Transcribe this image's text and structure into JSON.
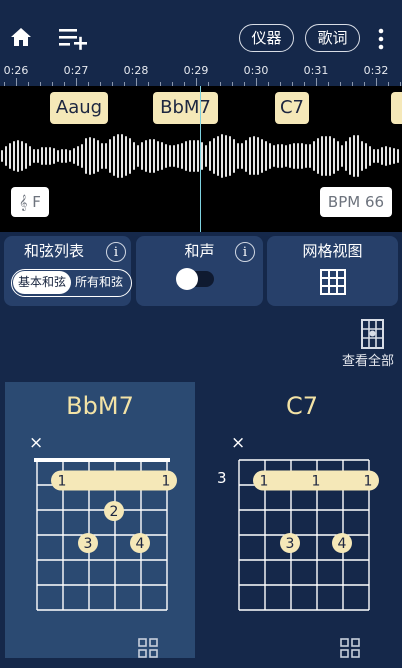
{
  "header": {
    "home_icon": "home-icon",
    "playlist_icon": "playlist-add-icon",
    "instrument_label": "仪器",
    "lyrics_label": "歌词",
    "more_icon": "more-vertical-icon"
  },
  "timeline": {
    "labels": [
      "0:26",
      "0:27",
      "0:28",
      "0:29",
      "0:30",
      "0:31",
      "0:32"
    ]
  },
  "waveform": {
    "chords": [
      "Aaug",
      "BbM7",
      "C7"
    ],
    "key_label": "F",
    "key_icon": "treble-clef-icon",
    "bpm_label": "BPM 66"
  },
  "panels": {
    "chord_list": {
      "title": "和弦列表",
      "info": "i",
      "options": [
        "基本和弦",
        "所有和弦"
      ],
      "selected": "基本和弦"
    },
    "harmony": {
      "title": "和声",
      "info": "i",
      "toggle_on": false
    },
    "grid_view": {
      "title": "网格视图",
      "icon": "grid-icon"
    }
  },
  "view_all": {
    "label": "查看全部",
    "icon": "chord-diagram-icon"
  },
  "chord_cards": [
    {
      "name": "BbM7",
      "selected": true,
      "muted_string_marker": "×",
      "fret_label": "",
      "barre_labels": [
        "1",
        "1"
      ],
      "finger_labels": [
        "2",
        "3",
        "4"
      ]
    },
    {
      "name": "C7",
      "selected": false,
      "muted_string_marker": "×",
      "fret_label": "3",
      "barre_labels": [
        "1",
        "1",
        "1"
      ],
      "finger_labels": [
        "3",
        "4"
      ]
    }
  ],
  "colors": {
    "background": "#15284a",
    "panel": "#27406a",
    "selected_card": "#2b4a72",
    "chord_tag": "#f5e8b8",
    "accent_text": "#f3e3a6"
  }
}
